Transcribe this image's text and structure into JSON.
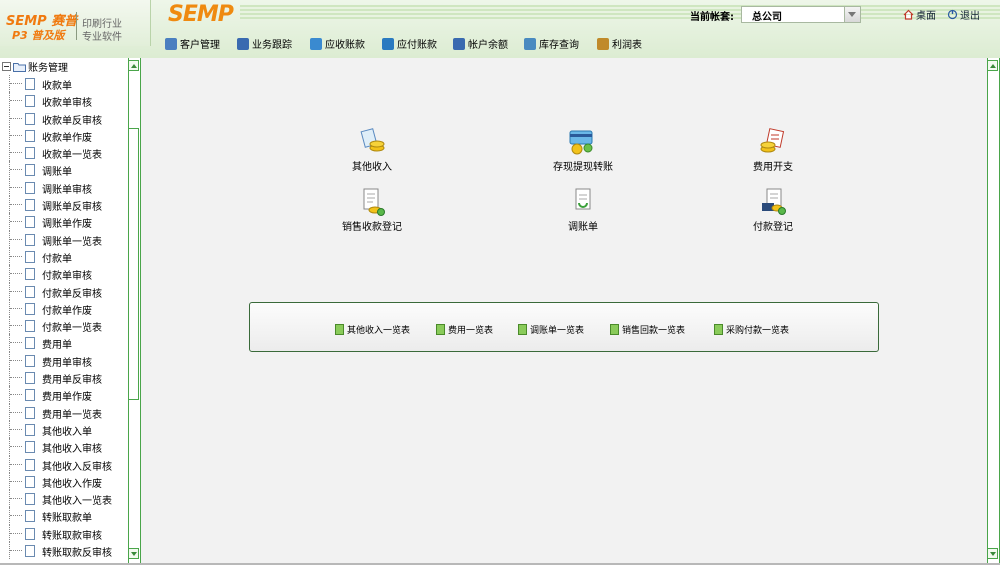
{
  "header": {
    "logo_main": "SEMP 赛普",
    "logo_sub": "P3 普及版",
    "logo_tagline_1": "印刷行业",
    "logo_tagline_2": "专业软件",
    "brand": "SEMP",
    "account_label": "当前帐套:",
    "account_value": "总公司",
    "desktop_link": "桌面",
    "logout_link": "退出"
  },
  "menu": [
    {
      "label": "客户管理",
      "icon": "user-icon",
      "color": "#4a7fc0"
    },
    {
      "label": "业务跟踪",
      "icon": "track-icon",
      "color": "#3a6ab0"
    },
    {
      "label": "应收账款",
      "icon": "receivable-icon",
      "color": "#3a8ad0"
    },
    {
      "label": "应付账款",
      "icon": "payable-icon",
      "color": "#2a7ac0"
    },
    {
      "label": "帐户余额",
      "icon": "balance-icon",
      "color": "#3a6ab0"
    },
    {
      "label": "库存查询",
      "icon": "stock-icon",
      "color": "#4a8ac0"
    },
    {
      "label": "利润表",
      "icon": "profit-icon",
      "color": "#c08a2a"
    }
  ],
  "tree": {
    "root": "账务管理",
    "items": [
      "收款单",
      "收款单审核",
      "收款单反审核",
      "收款单作废",
      "收款单一览表",
      "调账单",
      "调账单审核",
      "调账单反审核",
      "调账单作废",
      "调账单一览表",
      "付款单",
      "付款单审核",
      "付款单反审核",
      "付款单作废",
      "付款单一览表",
      "费用单",
      "费用单审核",
      "费用单反审核",
      "费用单作废",
      "费用单一览表",
      "其他收入单",
      "其他收入审核",
      "其他收入反审核",
      "其他收入作废",
      "其他收入一览表",
      "转账取款单",
      "转账取款审核",
      "转账取款反审核"
    ]
  },
  "actions": [
    {
      "label": "其他收入",
      "icon": "other-income-icon"
    },
    {
      "label": "存现提现转账",
      "icon": "deposit-transfer-icon"
    },
    {
      "label": "费用开支",
      "icon": "expense-icon"
    },
    {
      "label": "销售收款登记",
      "icon": "sales-receipt-icon"
    },
    {
      "label": "调账单",
      "icon": "adjust-icon"
    },
    {
      "label": "付款登记",
      "icon": "payment-icon"
    }
  ],
  "quick_links": [
    "其他收入一览表",
    "费用一览表",
    "调账单一览表",
    "销售回款一览表",
    "采购付款一览表"
  ],
  "colors": {
    "accent_orange": "#ef8a10",
    "border_green": "#4aa54a",
    "main_bg": "#f2f2f2"
  }
}
